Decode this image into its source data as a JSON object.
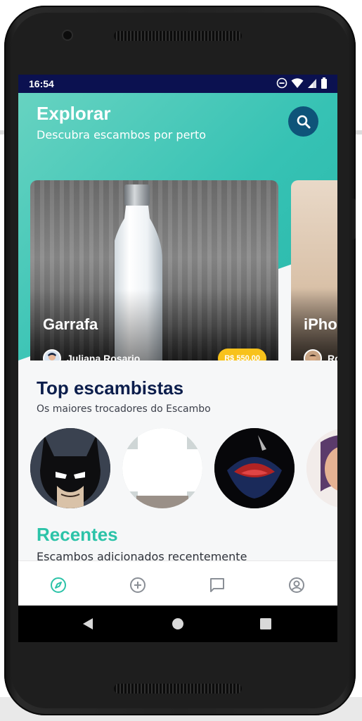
{
  "status_bar": {
    "time": "16:54",
    "icons": [
      "do-not-disturb-icon",
      "wifi-icon",
      "signal-icon",
      "battery-icon"
    ]
  },
  "header": {
    "title": "Explorar",
    "subtitle": "Descubra escambos por perto",
    "search_icon": "search-icon"
  },
  "featured": [
    {
      "title": "Garrafa",
      "owner": "Juliana Rosario",
      "price": "R$ 550,00"
    },
    {
      "title": "iPho",
      "owner": "Ro",
      "price": ""
    }
  ],
  "top_traders": {
    "title": "Top escambistas",
    "subtitle": "Os maiores trocadores do Escambo",
    "avatars": [
      "batman-avatar",
      "blank-avatar",
      "superman-avatar",
      "woman-avatar"
    ]
  },
  "recent": {
    "title": "Recentes",
    "subtitle": "Escambos adicionados recentemente"
  },
  "bottom_nav": [
    {
      "icon": "compass-icon",
      "active": true
    },
    {
      "icon": "add-circle-icon",
      "active": false
    },
    {
      "icon": "chat-icon",
      "active": false
    },
    {
      "icon": "profile-icon",
      "active": false
    }
  ],
  "colors": {
    "status_bar": "#0b1150",
    "accent": "#2cc3a8",
    "search_button": "#0e5479",
    "price_badge": "#f8c21b",
    "heading_dark": "#0c1e4c"
  }
}
